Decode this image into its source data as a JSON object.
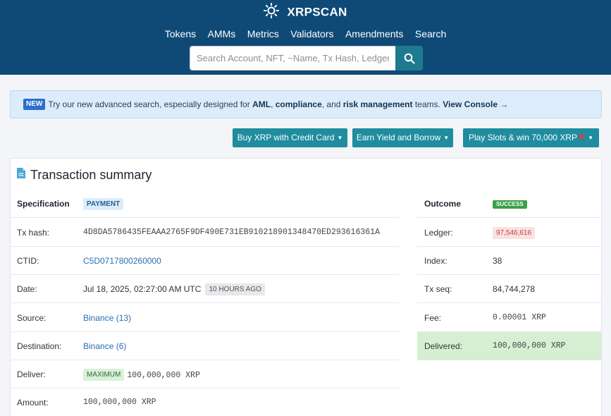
{
  "header": {
    "brand": "XRPSCAN",
    "nav": [
      "Tokens",
      "AMMs",
      "Metrics",
      "Validators",
      "Amendments",
      "Search"
    ],
    "search_placeholder": "Search Account, NFT, ~Name, Tx Hash, Ledger"
  },
  "banner": {
    "badge": "NEW",
    "text_1": "Try our new advanced search, especially designed for ",
    "aml": "AML",
    "text_2": ", ",
    "compliance": "compliance",
    "text_3": ", and ",
    "risk": "risk management",
    "text_4": " teams. ",
    "view_console": "View Console",
    "arrow": "→"
  },
  "actions": [
    {
      "label": "Buy XRP with Credit Card"
    },
    {
      "label": "Earn Yield and Borrow"
    },
    {
      "label": "Play Slots & win 70,000 XRP"
    }
  ],
  "card": {
    "title": "Transaction summary",
    "left": {
      "specification_label": "Specification",
      "specification_value": "PAYMENT",
      "tx_hash_label": "Tx hash:",
      "tx_hash_value": "4D8DA5786435FEAAA2765F9DF490E731EB910218901348470ED293616361A",
      "ctid_label": "CTID:",
      "ctid_value": "C5D0717800260000",
      "date_label": "Date:",
      "date_value": "Jul 18, 2025, 02:27:00 AM UTC",
      "date_ago": "10 HOURS AGO",
      "source_label": "Source:",
      "source_value": "Binance (13)",
      "destination_label": "Destination:",
      "destination_value": "Binance (6)",
      "deliver_label": "Deliver:",
      "deliver_tag": "MAXIMUM",
      "deliver_value": "100,000,000 XRP",
      "amount_label": "Amount:",
      "amount_value": "100,000,000 XRP"
    },
    "right": {
      "outcome_label": "Outcome",
      "outcome_value": "SUCCESS",
      "ledger_label": "Ledger:",
      "ledger_value": "97,546,616",
      "index_label": "Index:",
      "index_value": "38",
      "txseq_label": "Tx seq:",
      "txseq_value": "84,744,278",
      "fee_label": "Fee:",
      "fee_value": "0.00001 XRP",
      "delivered_label": "Delivered:",
      "delivered_value": "100,000,000 XRP"
    }
  },
  "colors": {
    "header": "#0f4a77",
    "button": "#1f8ca0",
    "success": "#3ba048",
    "ledger": "#c24040",
    "delivered_bg": "#d6efd3"
  }
}
